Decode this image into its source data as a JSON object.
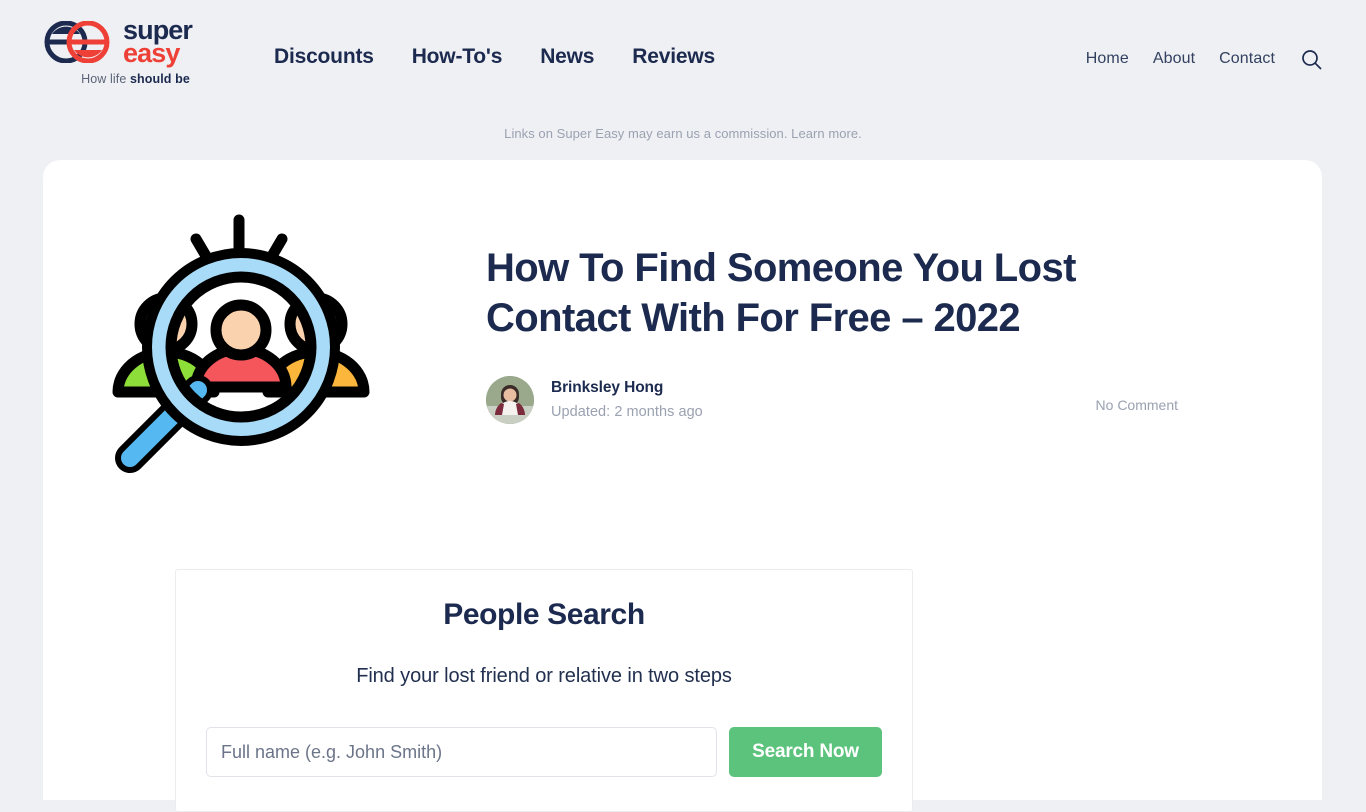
{
  "brand": {
    "word_one": "super",
    "word_two": "easy",
    "tagline_prefix": "How life ",
    "tagline_bold": "should be",
    "navy": "#1b2a4e",
    "red": "#ee4036",
    "logo_icon": "double-e-circles-logo"
  },
  "nav": {
    "primary": [
      {
        "label": "Discounts"
      },
      {
        "label": "How-To's"
      },
      {
        "label": "News"
      },
      {
        "label": "Reviews"
      }
    ],
    "secondary": [
      {
        "label": "Home"
      },
      {
        "label": "About"
      },
      {
        "label": "Contact"
      }
    ],
    "search_icon": "search-icon"
  },
  "disclosure": {
    "text": "Links on Super Easy may earn us a commission.",
    "link": "Learn more."
  },
  "article": {
    "hero_icon": "people-search-magnifier-illustration",
    "title": "How To Find Someone You Lost Contact With For Free – 2022",
    "author": "Brinksley Hong",
    "updated": "Updated: 2 months ago",
    "comments": "No Comment",
    "avatar_icon": "author-avatar-photo"
  },
  "widget": {
    "title": "People Search",
    "subtitle": "Find your lost friend or relative in two steps",
    "input_placeholder": "Full name (e.g. John Smith)",
    "input_value": "",
    "button_label": "Search Now",
    "button_color": "#5cc37c"
  }
}
